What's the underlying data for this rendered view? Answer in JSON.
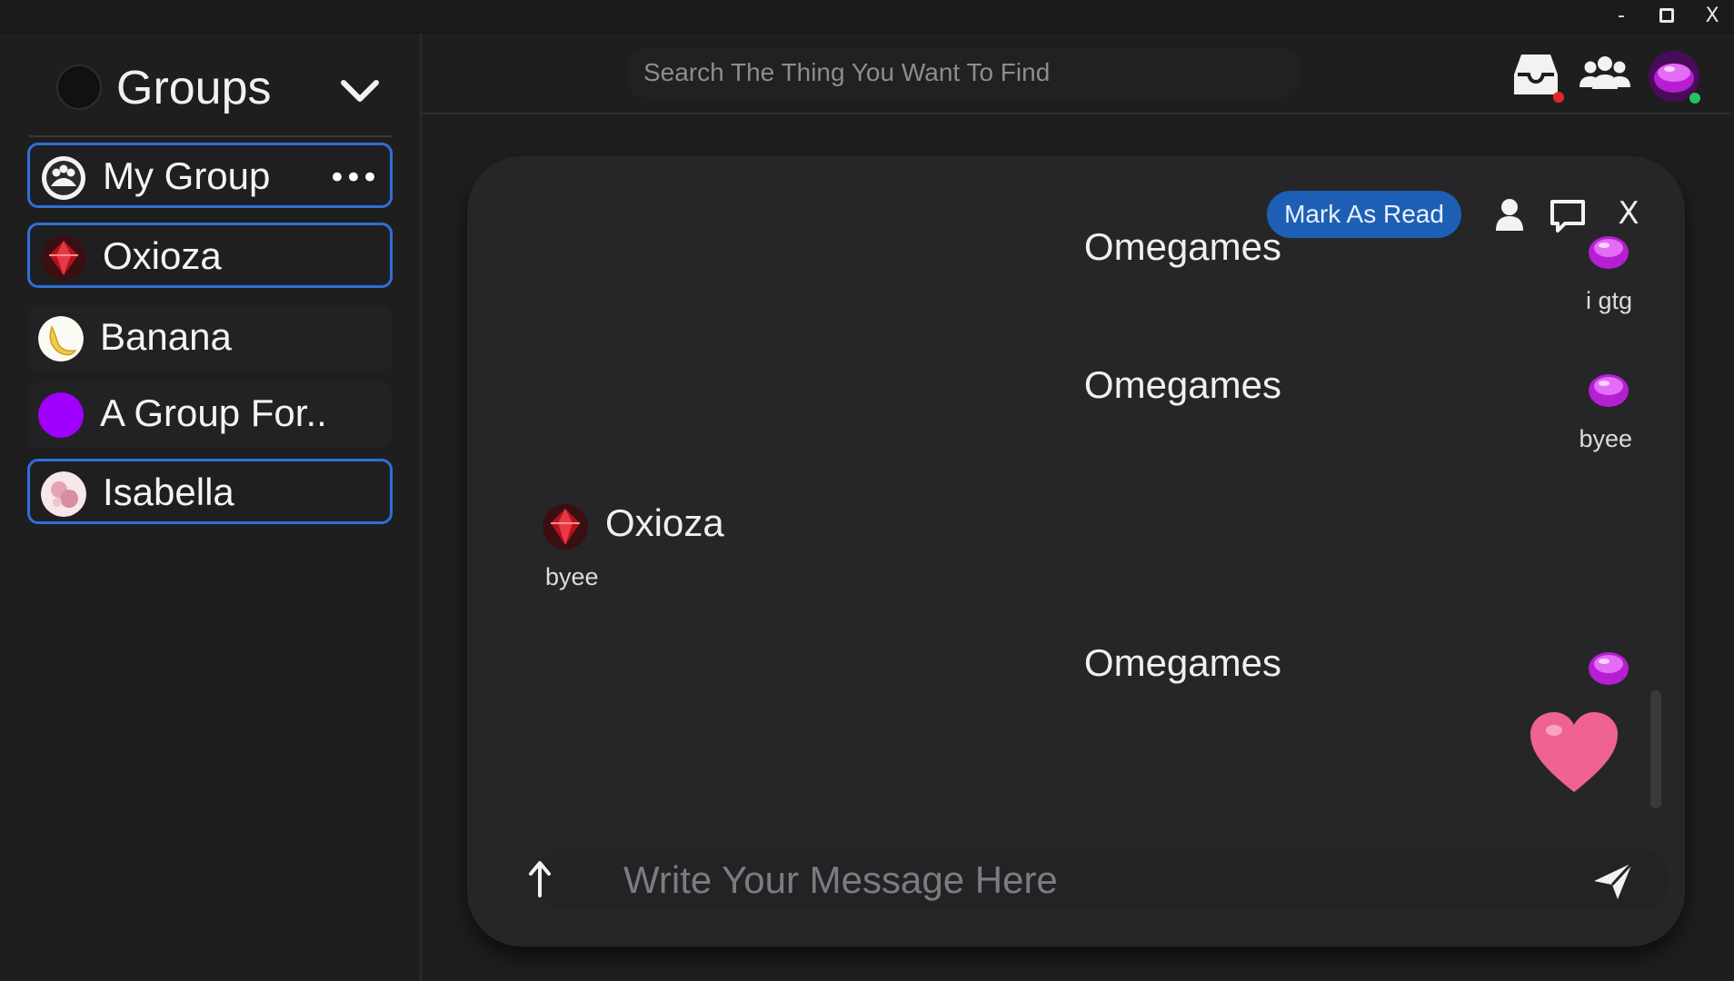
{
  "window": {
    "minimize": "-",
    "close": "X"
  },
  "sidebar": {
    "title": "Groups",
    "items": [
      {
        "label": "My Group",
        "more": "•••"
      },
      {
        "label": "Oxioza"
      },
      {
        "label": "Banana"
      },
      {
        "label": "A Group For.."
      },
      {
        "label": "Isabella"
      }
    ]
  },
  "search": {
    "placeholder": "Search The Thing You Want To Find"
  },
  "chat": {
    "mark_as_read": "Mark As Read",
    "close": "X",
    "messages": [
      {
        "author": "Omegames",
        "text": "i gtg"
      },
      {
        "author": "Omegames",
        "text": "byee"
      },
      {
        "author": "Oxioza",
        "text": "byee"
      },
      {
        "author": "Omegames",
        "text": "heart-emoji"
      }
    ],
    "composer_placeholder": "Write Your Message Here"
  },
  "colors": {
    "accent": "#2f6fd6",
    "mark_read_bg": "#1d5fb4",
    "notification_dot": "#e0262c",
    "online_dot": "#22c55e",
    "heart": "#f06292"
  }
}
